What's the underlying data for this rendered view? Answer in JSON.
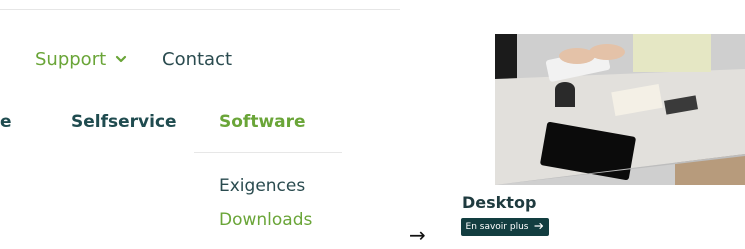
{
  "nav": {
    "support_label": "Support",
    "support_icon": "chevron-down-icon",
    "contact_label": "Contact"
  },
  "categories": [
    {
      "label": "e"
    },
    {
      "label": "Selfservice"
    },
    {
      "label": "Software"
    }
  ],
  "submenu": [
    {
      "label": "Exigences"
    },
    {
      "label": "Downloads"
    }
  ],
  "card": {
    "title": "Desktop",
    "cta_label": "En savoir plus",
    "cta_icon": "arrow-right-icon"
  },
  "connector_glyph": "→",
  "colors": {
    "accent_green": "#6aa538",
    "dark_teal": "#1f4b4f",
    "cta_bg": "#123d40"
  }
}
